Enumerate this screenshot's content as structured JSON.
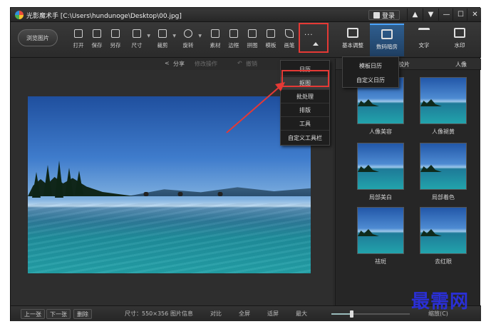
{
  "window": {
    "title": "光影魔术手 [C:\\Users\\hundunoge\\Desktop\\00.jpg]",
    "login_label": "登录",
    "controls": [
      "▲",
      "▼",
      "—",
      "☐",
      "✕"
    ]
  },
  "toolbar": {
    "open_label": "浏览图片",
    "tools": [
      {
        "label": "打开",
        "icon": "open-icon"
      },
      {
        "label": "保存",
        "icon": "save-icon"
      },
      {
        "label": "另存",
        "icon": "save-as-icon"
      },
      {
        "label": "尺寸",
        "icon": "resize-icon"
      },
      {
        "label": "裁剪",
        "icon": "crop-icon"
      },
      {
        "label": "旋转",
        "icon": "rotate-icon"
      },
      {
        "label": "素材",
        "icon": "material-icon"
      },
      {
        "label": "边框",
        "icon": "frame-icon"
      },
      {
        "label": "拼图",
        "icon": "puzzle-icon"
      },
      {
        "label": "模板",
        "icon": "template-icon"
      },
      {
        "label": "画笔",
        "icon": "brush-icon"
      }
    ],
    "more_label": "...",
    "big_tabs": [
      {
        "label": "基本调整",
        "icon": "adjust-icon"
      },
      {
        "label": "数码暗房",
        "icon": "darkroom-icon"
      },
      {
        "label": "文字",
        "icon": "text-icon"
      },
      {
        "label": "水印",
        "icon": "watermark-icon"
      }
    ]
  },
  "subbar": {
    "share": "分享",
    "history": "修改操作",
    "undo": "撤销"
  },
  "dropdown": {
    "items": [
      "日历",
      "抠图",
      "批处理",
      "排版",
      "工具",
      "自定义工具栏"
    ]
  },
  "submenu": {
    "items": [
      "模板日历",
      "自定义日历"
    ]
  },
  "panel": {
    "tabs": [
      "胶片",
      "人像"
    ],
    "thumbs": [
      "人像美容",
      "人像褪黄",
      "局部美白",
      "局部着色",
      "祛斑",
      "去红眼"
    ]
  },
  "statusbar": {
    "prev": "上一张",
    "next": "下一张",
    "delete": "删除",
    "size": "尺寸：550×356",
    "info": "图片信息",
    "compare": "对比",
    "fullscreen": "全屏",
    "fit": "适屏",
    "max": "最大",
    "zoom_level": 0.25,
    "zoom_text": "缩放(C)"
  },
  "watermark": "最需网",
  "colors": {
    "highlight_red": "#e53935",
    "active_tab": "#2f5e8e",
    "watermark_blue": "#2a2fd4"
  }
}
